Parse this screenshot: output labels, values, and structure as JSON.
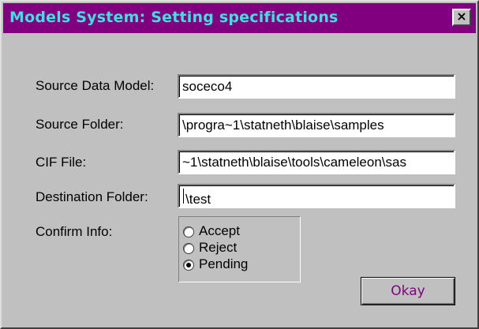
{
  "window": {
    "title": "Models System: Setting specifications",
    "close_glyph": "×"
  },
  "form": {
    "source_data_model": {
      "label": "Source Data Model:",
      "value": "soceco4"
    },
    "source_folder": {
      "label": "Source Folder:",
      "value": "\\progra~1\\statneth\\blaise\\samples"
    },
    "cif_file": {
      "label": "CIF File:",
      "value": "~1\\statneth\\blaise\\tools\\cameleon\\sas"
    },
    "destination_folder": {
      "label": "Destination Folder:",
      "value": "\\test"
    },
    "confirm_info": {
      "label": "Confirm Info:",
      "options": [
        {
          "label": "Accept",
          "checked": false
        },
        {
          "label": "Reject",
          "checked": false
        },
        {
          "label": "Pending",
          "checked": true
        }
      ]
    },
    "okay_label": "Okay"
  },
  "colors": {
    "titlebar": "#800080",
    "title_text": "#40e0e0",
    "dialog_bg": "#c0c0c0",
    "okay_text": "#800080"
  },
  "icons": {
    "close": "close-icon"
  }
}
